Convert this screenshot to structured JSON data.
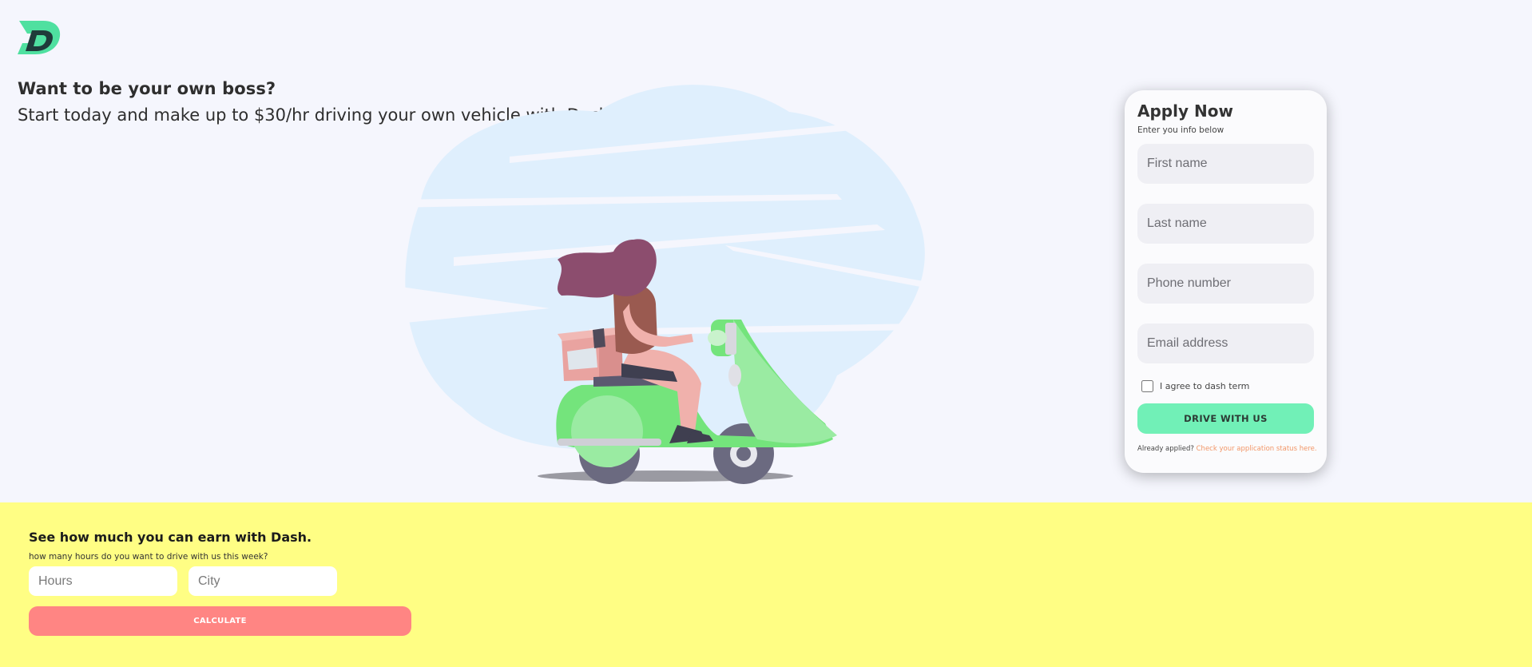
{
  "brand": {
    "logo_icon": "dash-logo-icon",
    "accent": "#71f0b7"
  },
  "hero": {
    "title": "Want to be your own boss?",
    "subtitle": "Start today and make up to $30/hr driving your own vehicle with Dash!"
  },
  "apply": {
    "title": "Apply Now",
    "subtitle": "Enter you info below",
    "first_name_placeholder": "First name",
    "last_name_placeholder": "Last name",
    "phone_placeholder": "Phone number",
    "email_placeholder": "Email address",
    "agree_label": "I agree to dash term",
    "agree_checked": false,
    "submit_label": "DRIVE WITH US",
    "already_text": "Already applied?",
    "status_link": "Check your application status here."
  },
  "earn": {
    "title": "See how much you can earn with Dash.",
    "subtitle": "how many hours do you want to drive with us this week?",
    "hours_placeholder": "Hours",
    "city_placeholder": "City",
    "calculate_label": "CALCULATE",
    "background": "#fffe84",
    "button_color": "#ff8583"
  }
}
